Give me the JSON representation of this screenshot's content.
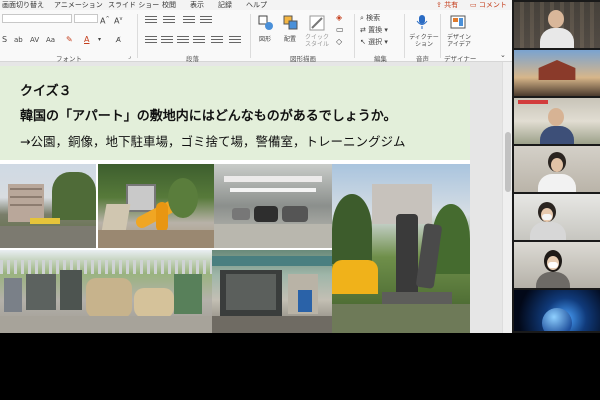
{
  "ribbon": {
    "tabs": [
      "画面切り替え",
      "アニメーション",
      "スライド ショー",
      "校閲",
      "表示",
      "記録",
      "ヘルプ"
    ],
    "share_label": "共有",
    "comment_label": "コメント",
    "groups": {
      "font": "フォント",
      "paragraph": "段落",
      "drawing": "図形描画",
      "editing": "編集",
      "voice": "音声",
      "designer": "デザイナー"
    },
    "buttons": {
      "shape": "図形",
      "arrange": "配置",
      "quick_style": "クイック スタイル",
      "find": "検索",
      "replace": "置換",
      "select": "選択",
      "dictate": "ディクテーション",
      "design_ideas": "デザイン アイデア"
    }
  },
  "slide": {
    "quiz_title": "クイズ３",
    "question": "韓国の「アパート」の敷地内にはどんなものがあるでしょうか。",
    "answer": "→公園，銅像，地下駐車場，ゴミ捨て場，警備室，トレーニングジム"
  },
  "colors": {
    "header_bg": "#e3efda",
    "accent_red": "#c43e1c",
    "gallery_bg": "#1a1a1a"
  },
  "gallery": {
    "participant_count": 7
  }
}
